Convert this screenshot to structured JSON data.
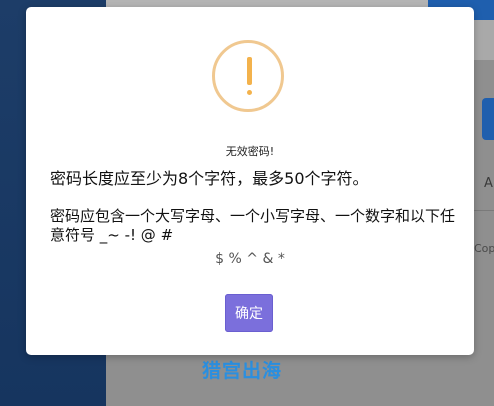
{
  "background": {
    "side_letter": "A",
    "side_text": "Cop",
    "watermark": "猎宫出海"
  },
  "dialog": {
    "icon": "warning-exclamation-icon",
    "title": "无效密码!",
    "message_line1": "密码长度应至少为8个字符，最多50个字符。",
    "message_line2": "密码应包含一个大写字母、一个小写字母、一个数字和以下任意符号 _~ -! @ #",
    "message_line3": "$ % ^ & *",
    "ok_label": "确定"
  },
  "colors": {
    "accent_button": "#7b6fdc",
    "warning_ring": "#f0c890",
    "warning_mark": "#f3b24c"
  }
}
